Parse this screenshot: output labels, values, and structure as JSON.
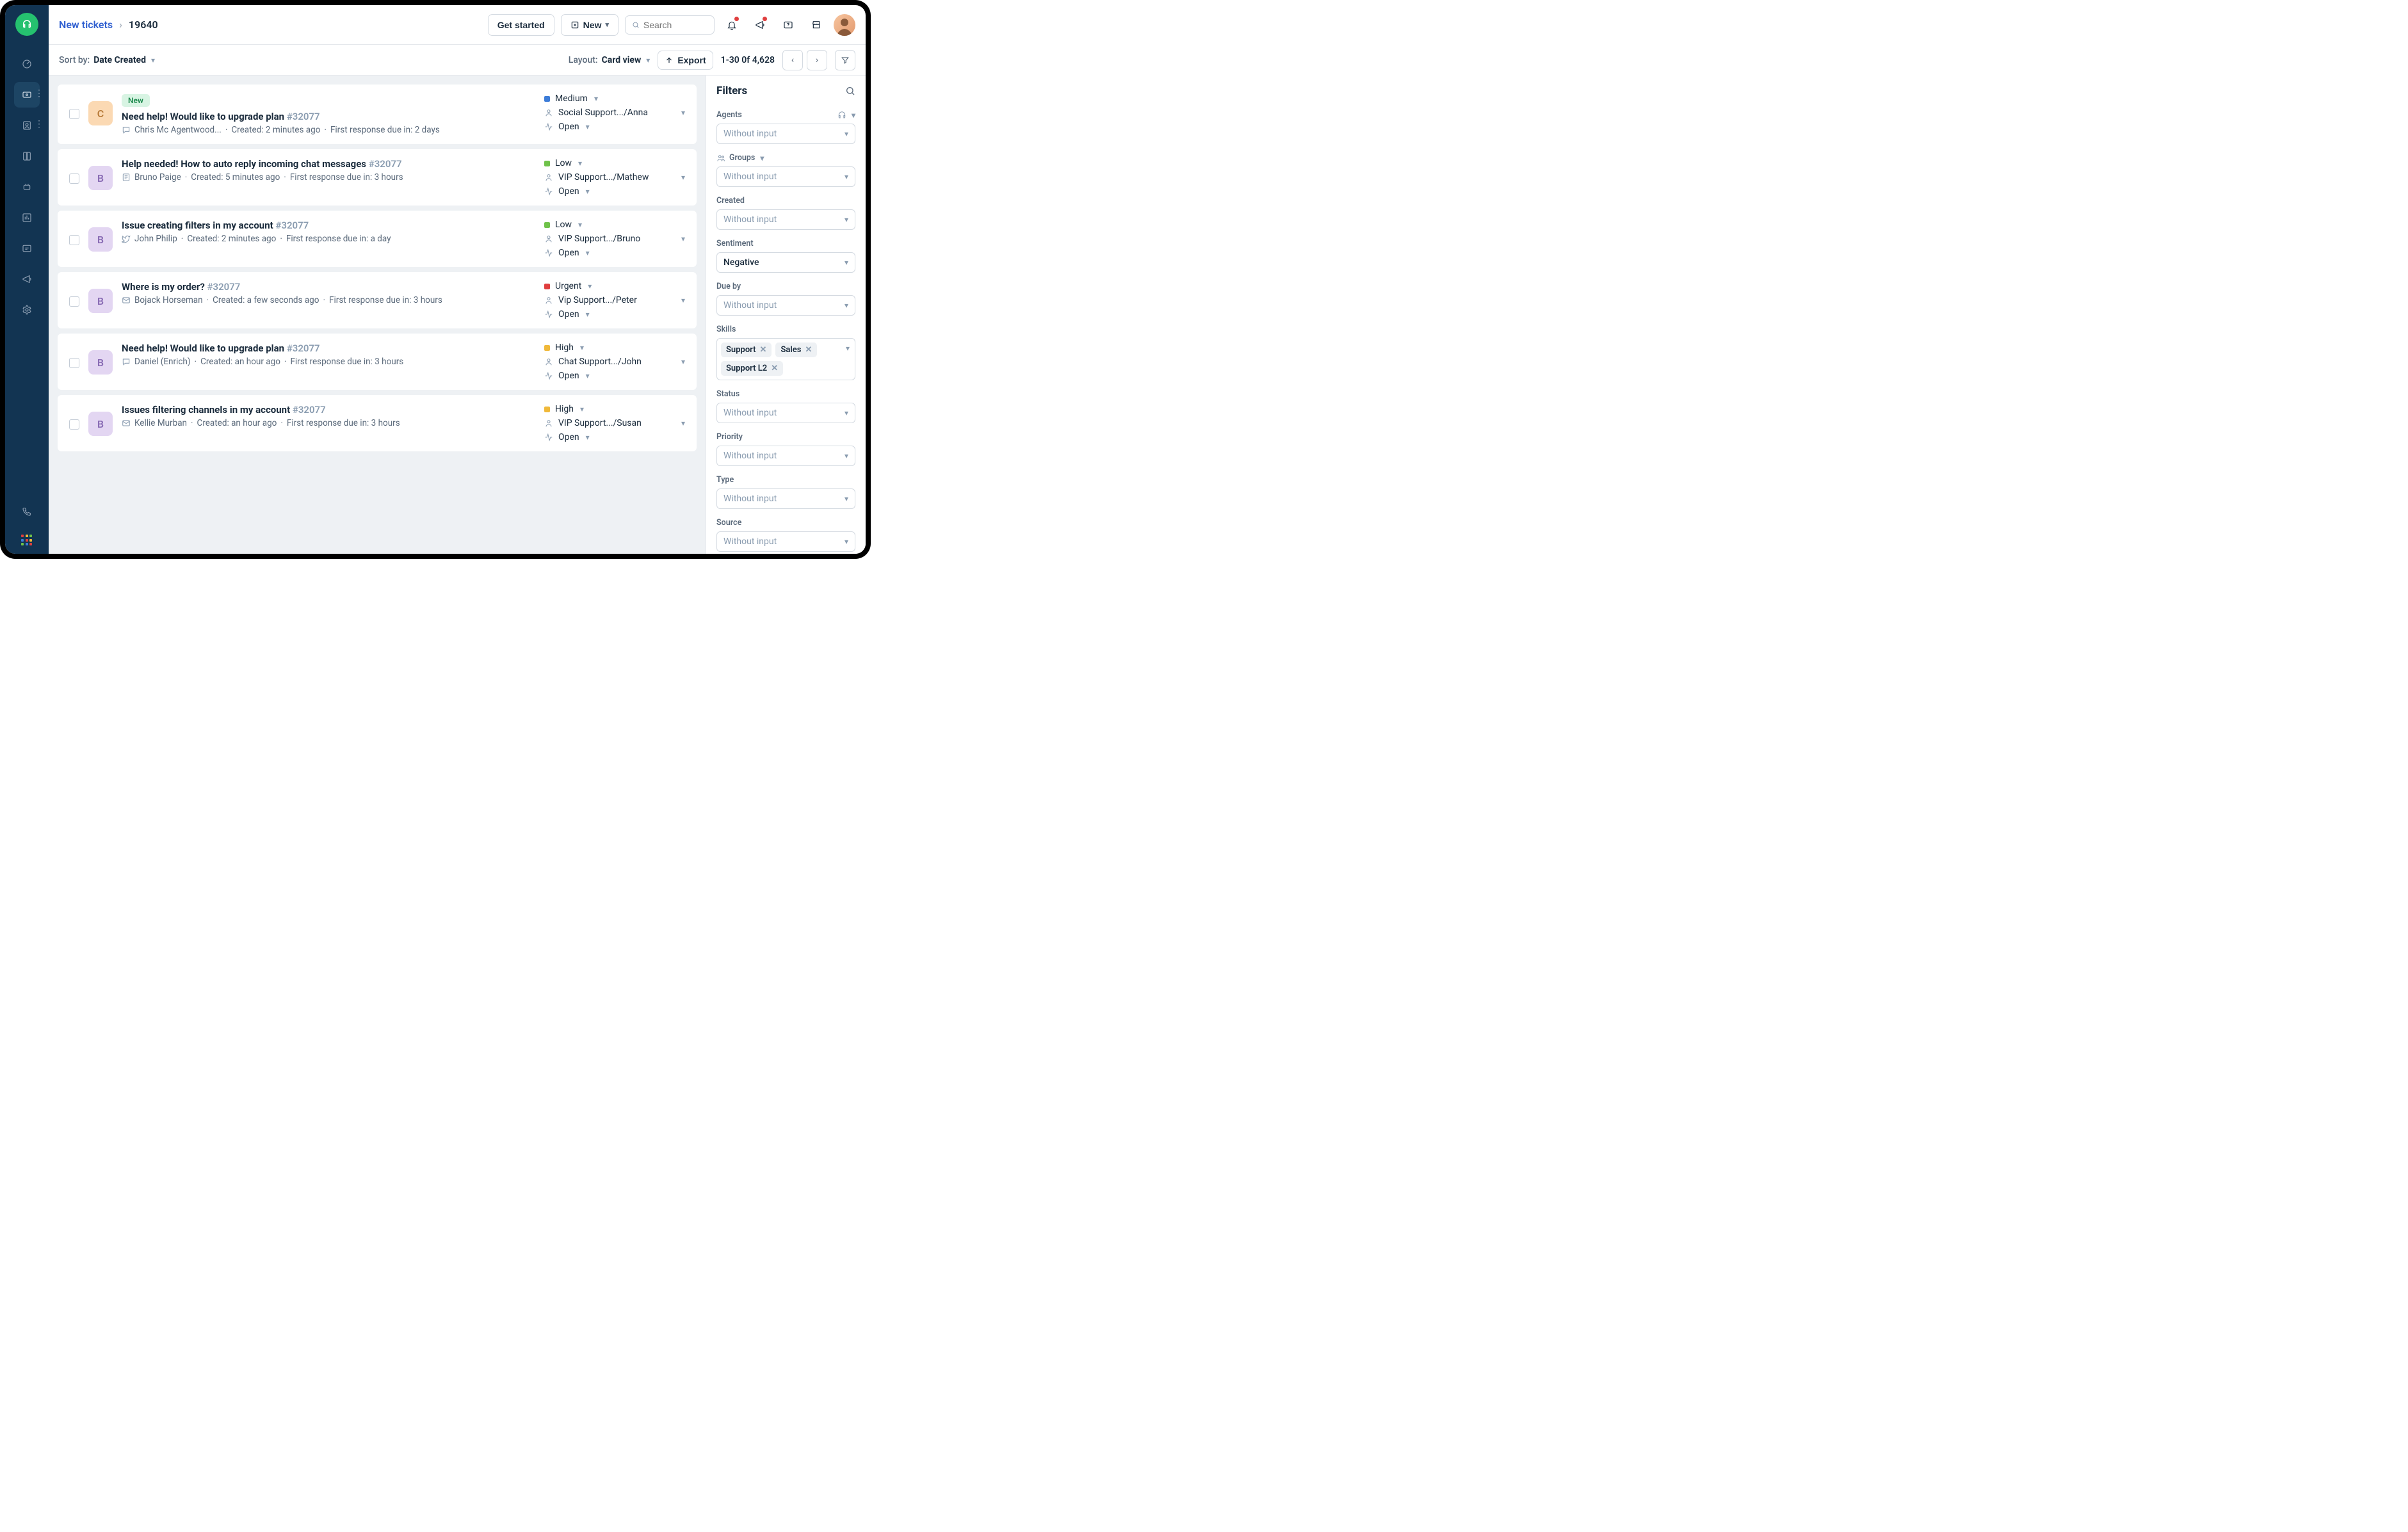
{
  "breadcrumb": {
    "link": "New tickets",
    "id": "19640"
  },
  "topbar": {
    "get_started": "Get started",
    "new_label": "New",
    "search_placeholder": "Search"
  },
  "toolbar": {
    "sort_label": "Sort by:",
    "sort_value": "Date Created",
    "layout_label": "Layout:",
    "layout_value": "Card view",
    "export_label": "Export",
    "pagination": "1-30 0f 4,628"
  },
  "tickets": [
    {
      "avatar_letter": "C",
      "avatar_bg": "#fbd9b3",
      "avatar_fg": "#b87b3a",
      "badge": "New",
      "title": "Need help! Would like to upgrade plan",
      "ticket_no": "#32077",
      "source_icon": "chat",
      "author": "Chris Mc Agentwood...",
      "created": "Created: 2 minutes ago",
      "due": "First response due in: 2 days",
      "priority": "Medium",
      "priority_color": "#3d7dd8",
      "assignee": "Social Support.../Anna",
      "status": "Open"
    },
    {
      "avatar_letter": "B",
      "avatar_bg": "#e3d6f2",
      "avatar_fg": "#8a6db5",
      "title": "Help needed! How to auto reply incoming chat messages",
      "ticket_no": "#32077",
      "source_icon": "form",
      "author": "Bruno Paige",
      "created": "Created: 5 minutes ago",
      "due": "First response due in: 3 hours",
      "priority": "Low",
      "priority_color": "#6fc24a",
      "assignee": "VIP Support.../Mathew",
      "status": "Open"
    },
    {
      "avatar_letter": "B",
      "avatar_bg": "#e3d6f2",
      "avatar_fg": "#8a6db5",
      "title": "Issue creating filters in my account",
      "ticket_no": "#32077",
      "source_icon": "twitter",
      "author": "John Philip",
      "created": "Created: 2 minutes ago",
      "due": "First response due in: a day",
      "priority": "Low",
      "priority_color": "#6fc24a",
      "assignee": "VIP Support.../Bruno",
      "status": "Open"
    },
    {
      "avatar_letter": "B",
      "avatar_bg": "#e3d6f2",
      "avatar_fg": "#8a6db5",
      "title": "Where is my order?",
      "ticket_no": "#32077",
      "source_icon": "email",
      "author": "Bojack Horseman",
      "created": "Created: a few seconds ago",
      "due": "First response due in: 3 hours",
      "priority": "Urgent",
      "priority_color": "#e03e3e",
      "assignee": "Vip Support.../Peter",
      "status": "Open"
    },
    {
      "avatar_letter": "B",
      "avatar_bg": "#e3d6f2",
      "avatar_fg": "#8a6db5",
      "title": "Need help! Would like to upgrade plan",
      "ticket_no": "#32077",
      "source_icon": "chat",
      "author": "Daniel (Enrich)",
      "created": "Created: an hour ago",
      "due": "First response due in: 3 hours",
      "priority": "High",
      "priority_color": "#f0b93a",
      "assignee": "Chat Support.../John",
      "status": "Open"
    },
    {
      "avatar_letter": "B",
      "avatar_bg": "#e3d6f2",
      "avatar_fg": "#8a6db5",
      "title": "Issues filtering channels in my account",
      "ticket_no": "#32077",
      "source_icon": "email",
      "author": "Kellie Murban",
      "created": "Created: an hour ago",
      "due": "First response due in: 3 hours",
      "priority": "High",
      "priority_color": "#f0b93a",
      "assignee": "VIP Support.../Susan",
      "status": "Open"
    }
  ],
  "filters": {
    "title": "Filters",
    "placeholder": "Without input",
    "agents_label": "Agents",
    "groups_label": "Groups",
    "created_label": "Created",
    "sentiment_label": "Sentiment",
    "sentiment_value": "Negative",
    "dueby_label": "Due by",
    "skills_label": "Skills",
    "skills": [
      "Support",
      "Sales",
      "Support L2"
    ],
    "status_label": "Status",
    "priority_label": "Priority",
    "type_label": "Type",
    "source_label": "Source"
  }
}
